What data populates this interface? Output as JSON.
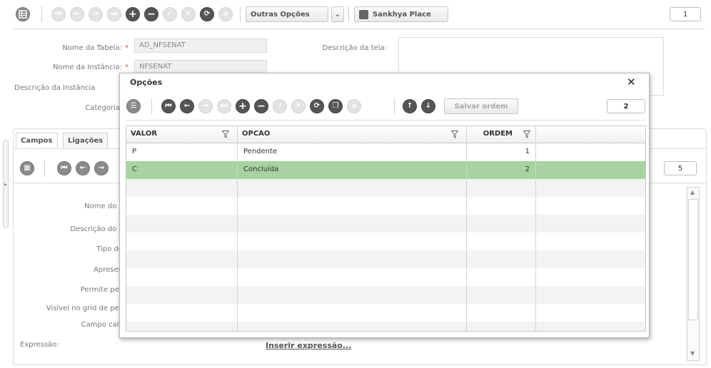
{
  "toolbar": {
    "outras_opcoes_label": "Outras Opções",
    "sankhya_place_label": "Sankhya Place",
    "page_number": "1"
  },
  "form": {
    "nome_tabela_label": "Nome da Tabela:",
    "nome_tabela_value": "AD_NFSENAT",
    "nome_instancia_label": "Nome da Instância:",
    "nome_instancia_value": "NFSENAT",
    "descricao_instancia_label": "Descrição da Instância",
    "categoria_label": "Categoria",
    "descricao_tela_label": "Descrição da tela:"
  },
  "tabs": [
    {
      "label": "Campos"
    },
    {
      "label": "Ligações"
    }
  ],
  "campos": {
    "page_number": "5",
    "labels": [
      "Nome do c",
      "Descrição do c",
      "Tipo de",
      "Apresen",
      "Permite pes",
      "Visível no grid de pes",
      "Campo calc"
    ],
    "expressao_label": "Expressão:",
    "inserir_expressao_link": "Inserir expressão..."
  },
  "modal": {
    "title": "Opções",
    "close_symbol": "✕",
    "salvar_ordem_label": "Salvar ordem",
    "page_number": "2",
    "columns": [
      "VALOR",
      "OPCAO",
      "ORDEM"
    ],
    "rows": [
      {
        "valor": "P",
        "opcao": "Pendente",
        "ordem": "1"
      },
      {
        "valor": "C",
        "opcao": "Concluída",
        "ordem": "2"
      }
    ],
    "selected_row": 1
  },
  "colors": {
    "selected_row": "#a6d3a0",
    "stripe": "#f3f3f3",
    "active_icon": "#555555",
    "disabled_icon": "#e3e3e3",
    "required_marker": "#e05050",
    "link": "#555555"
  },
  "icons": {
    "main_toolbar": [
      "grid-menu-icon",
      "first-icon",
      "previous-icon",
      "next-icon",
      "last-icon",
      "add-icon",
      "remove-icon",
      "confirm-icon",
      "cancel-icon",
      "refresh-icon",
      "attach-icon"
    ],
    "modal_toolbar": [
      "list-menu-icon",
      "first-icon",
      "previous-icon",
      "next-icon",
      "last-icon",
      "add-icon",
      "remove-icon",
      "confirm-icon",
      "cancel-icon",
      "refresh-icon",
      "copy-icon",
      "attach-icon",
      "move-up-icon",
      "move-down-icon"
    ]
  }
}
